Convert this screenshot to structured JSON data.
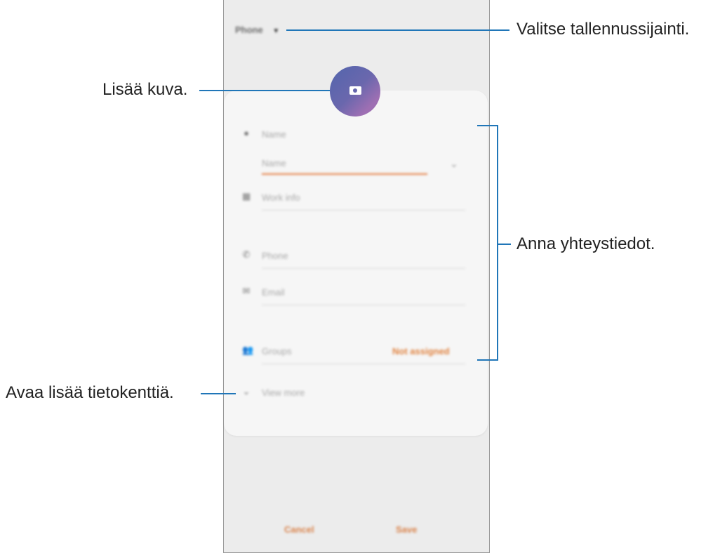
{
  "phone": {
    "storage_label": "Phone",
    "fields": {
      "name": "Name",
      "name_sub": "Name",
      "work_info": "Work info",
      "phone": "Phone",
      "email": "Email",
      "groups": "Groups",
      "groups_value": "Not assigned",
      "view_more": "View more"
    },
    "buttons": {
      "cancel": "Cancel",
      "save": "Save"
    }
  },
  "callouts": {
    "storage": "Valitse tallennussijainti.",
    "photo": "Lisää kuva.",
    "contact": "Anna yhteystiedot.",
    "more": "Avaa lisää tietokenttiä."
  },
  "colors": {
    "accent": "#e0823f",
    "leader": "#2076b8",
    "avatar": "#6a67ad"
  }
}
